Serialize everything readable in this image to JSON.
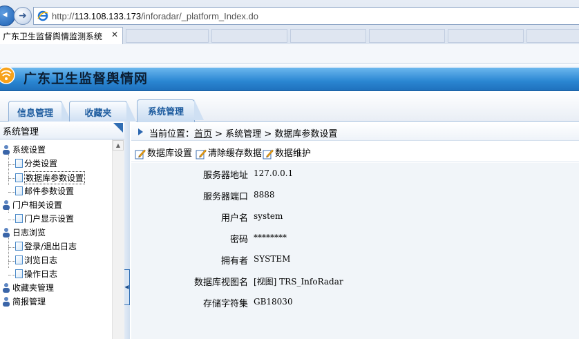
{
  "browser": {
    "url_prefix": "http://",
    "url_host": "113.108.133.173",
    "url_path": "/inforadar/_platform_Index.do",
    "tab_title": "广东卫生监督舆情监测系统",
    "tab_close": "✕"
  },
  "app": {
    "title": "广东卫生监督舆情网"
  },
  "module_tabs": [
    {
      "label": "信息管理"
    },
    {
      "label": "收藏夹"
    },
    {
      "label": "系统管理",
      "active": true
    }
  ],
  "sidebar": {
    "title": "系统管理",
    "tree": [
      {
        "label": "系统设置",
        "type": "folder",
        "level": 0
      },
      {
        "label": "分类设置",
        "type": "page",
        "level": 1
      },
      {
        "label": "数据库参数设置",
        "type": "page",
        "level": 1,
        "selected": true
      },
      {
        "label": "邮件参数设置",
        "type": "page",
        "level": 1
      },
      {
        "label": "门户相关设置",
        "type": "folder",
        "level": 0
      },
      {
        "label": "门户显示设置",
        "type": "page",
        "level": 1
      },
      {
        "label": "日志浏览",
        "type": "folder",
        "level": 0
      },
      {
        "label": "登录/退出日志",
        "type": "page",
        "level": 1
      },
      {
        "label": "浏览日志",
        "type": "page",
        "level": 1
      },
      {
        "label": "操作日志",
        "type": "page",
        "level": 1
      },
      {
        "label": "收藏夹管理",
        "type": "folder",
        "level": 0
      },
      {
        "label": "简报管理",
        "type": "folder",
        "level": 0
      }
    ]
  },
  "breadcrumb": {
    "prefix": "当前位置：",
    "home": "首页",
    "rest": " > 系统管理 > 数据库参数设置"
  },
  "actions": [
    {
      "label": "数据库设置",
      "icon": "edit-icon"
    },
    {
      "label": "清除缓存数据",
      "icon": "edit-icon"
    },
    {
      "label": "数据维护",
      "icon": "edit-icon"
    }
  ],
  "form": [
    {
      "label": "服务器地址",
      "value": "127.0.0.1"
    },
    {
      "label": "服务器端口",
      "value": "8888"
    },
    {
      "label": "用户名",
      "value": "system"
    },
    {
      "label": "密码",
      "value": "********"
    },
    {
      "label": "拥有者",
      "value": "SYSTEM"
    },
    {
      "label": "数据库视图名",
      "value": "[视图]  TRS_InfoRadar"
    },
    {
      "label": "存储字符集",
      "value": "GB18030"
    }
  ]
}
